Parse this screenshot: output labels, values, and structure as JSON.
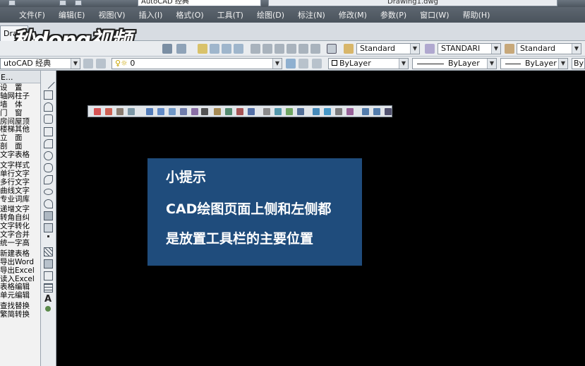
{
  "titlebar": {
    "workspace_combo": "AutoCAD 经典",
    "filename": "Drawing1.dwg"
  },
  "menu": [
    "文件(F)",
    "编辑(E)",
    "视图(V)",
    "插入(I)",
    "格式(O)",
    "工具(T)",
    "绘图(D)",
    "标注(N)",
    "修改(M)",
    "参数(P)",
    "窗口(W)",
    "帮助(H)"
  ],
  "tabs": {
    "drawing_tab": "Drav"
  },
  "watermark": {
    "text": "秒dong视频"
  },
  "toolbar1": {
    "text_style": "Standard",
    "dim_style": "STANDARI",
    "table_style": "Standard"
  },
  "toolbar2": {
    "workspace": "utoCAD 经典",
    "layer": "0",
    "color": "ByLayer",
    "linetype": "ByLayer",
    "lineweight": "ByLayer",
    "plotstyle": "By"
  },
  "left_panel": {
    "header": "E...",
    "items": [
      "设　置",
      "轴网柱子",
      "墙　体",
      "门　窗",
      "房间屋顶",
      "楼梯其他",
      "立　面",
      "剖　面",
      "文字表格",
      "文字样式",
      "单行文字",
      "多行文字",
      "曲线文字",
      "专业词库",
      "递增文字",
      "转角自纠",
      "文字转化",
      "文字合并",
      "统一字高",
      "新建表格",
      "导出Word",
      "导出Excel",
      "读入Excel",
      "表格编辑",
      "单元编辑",
      "查找替换",
      "繁简转换"
    ]
  },
  "tip": {
    "title": "小提示",
    "line1": "CAD绘图页面上侧和左侧都",
    "line2": "是放置工具栏的主要位置"
  },
  "colors": {
    "canvas": "#000000",
    "tip_bg": "#1f4c7c",
    "menubar": "#535c66"
  }
}
